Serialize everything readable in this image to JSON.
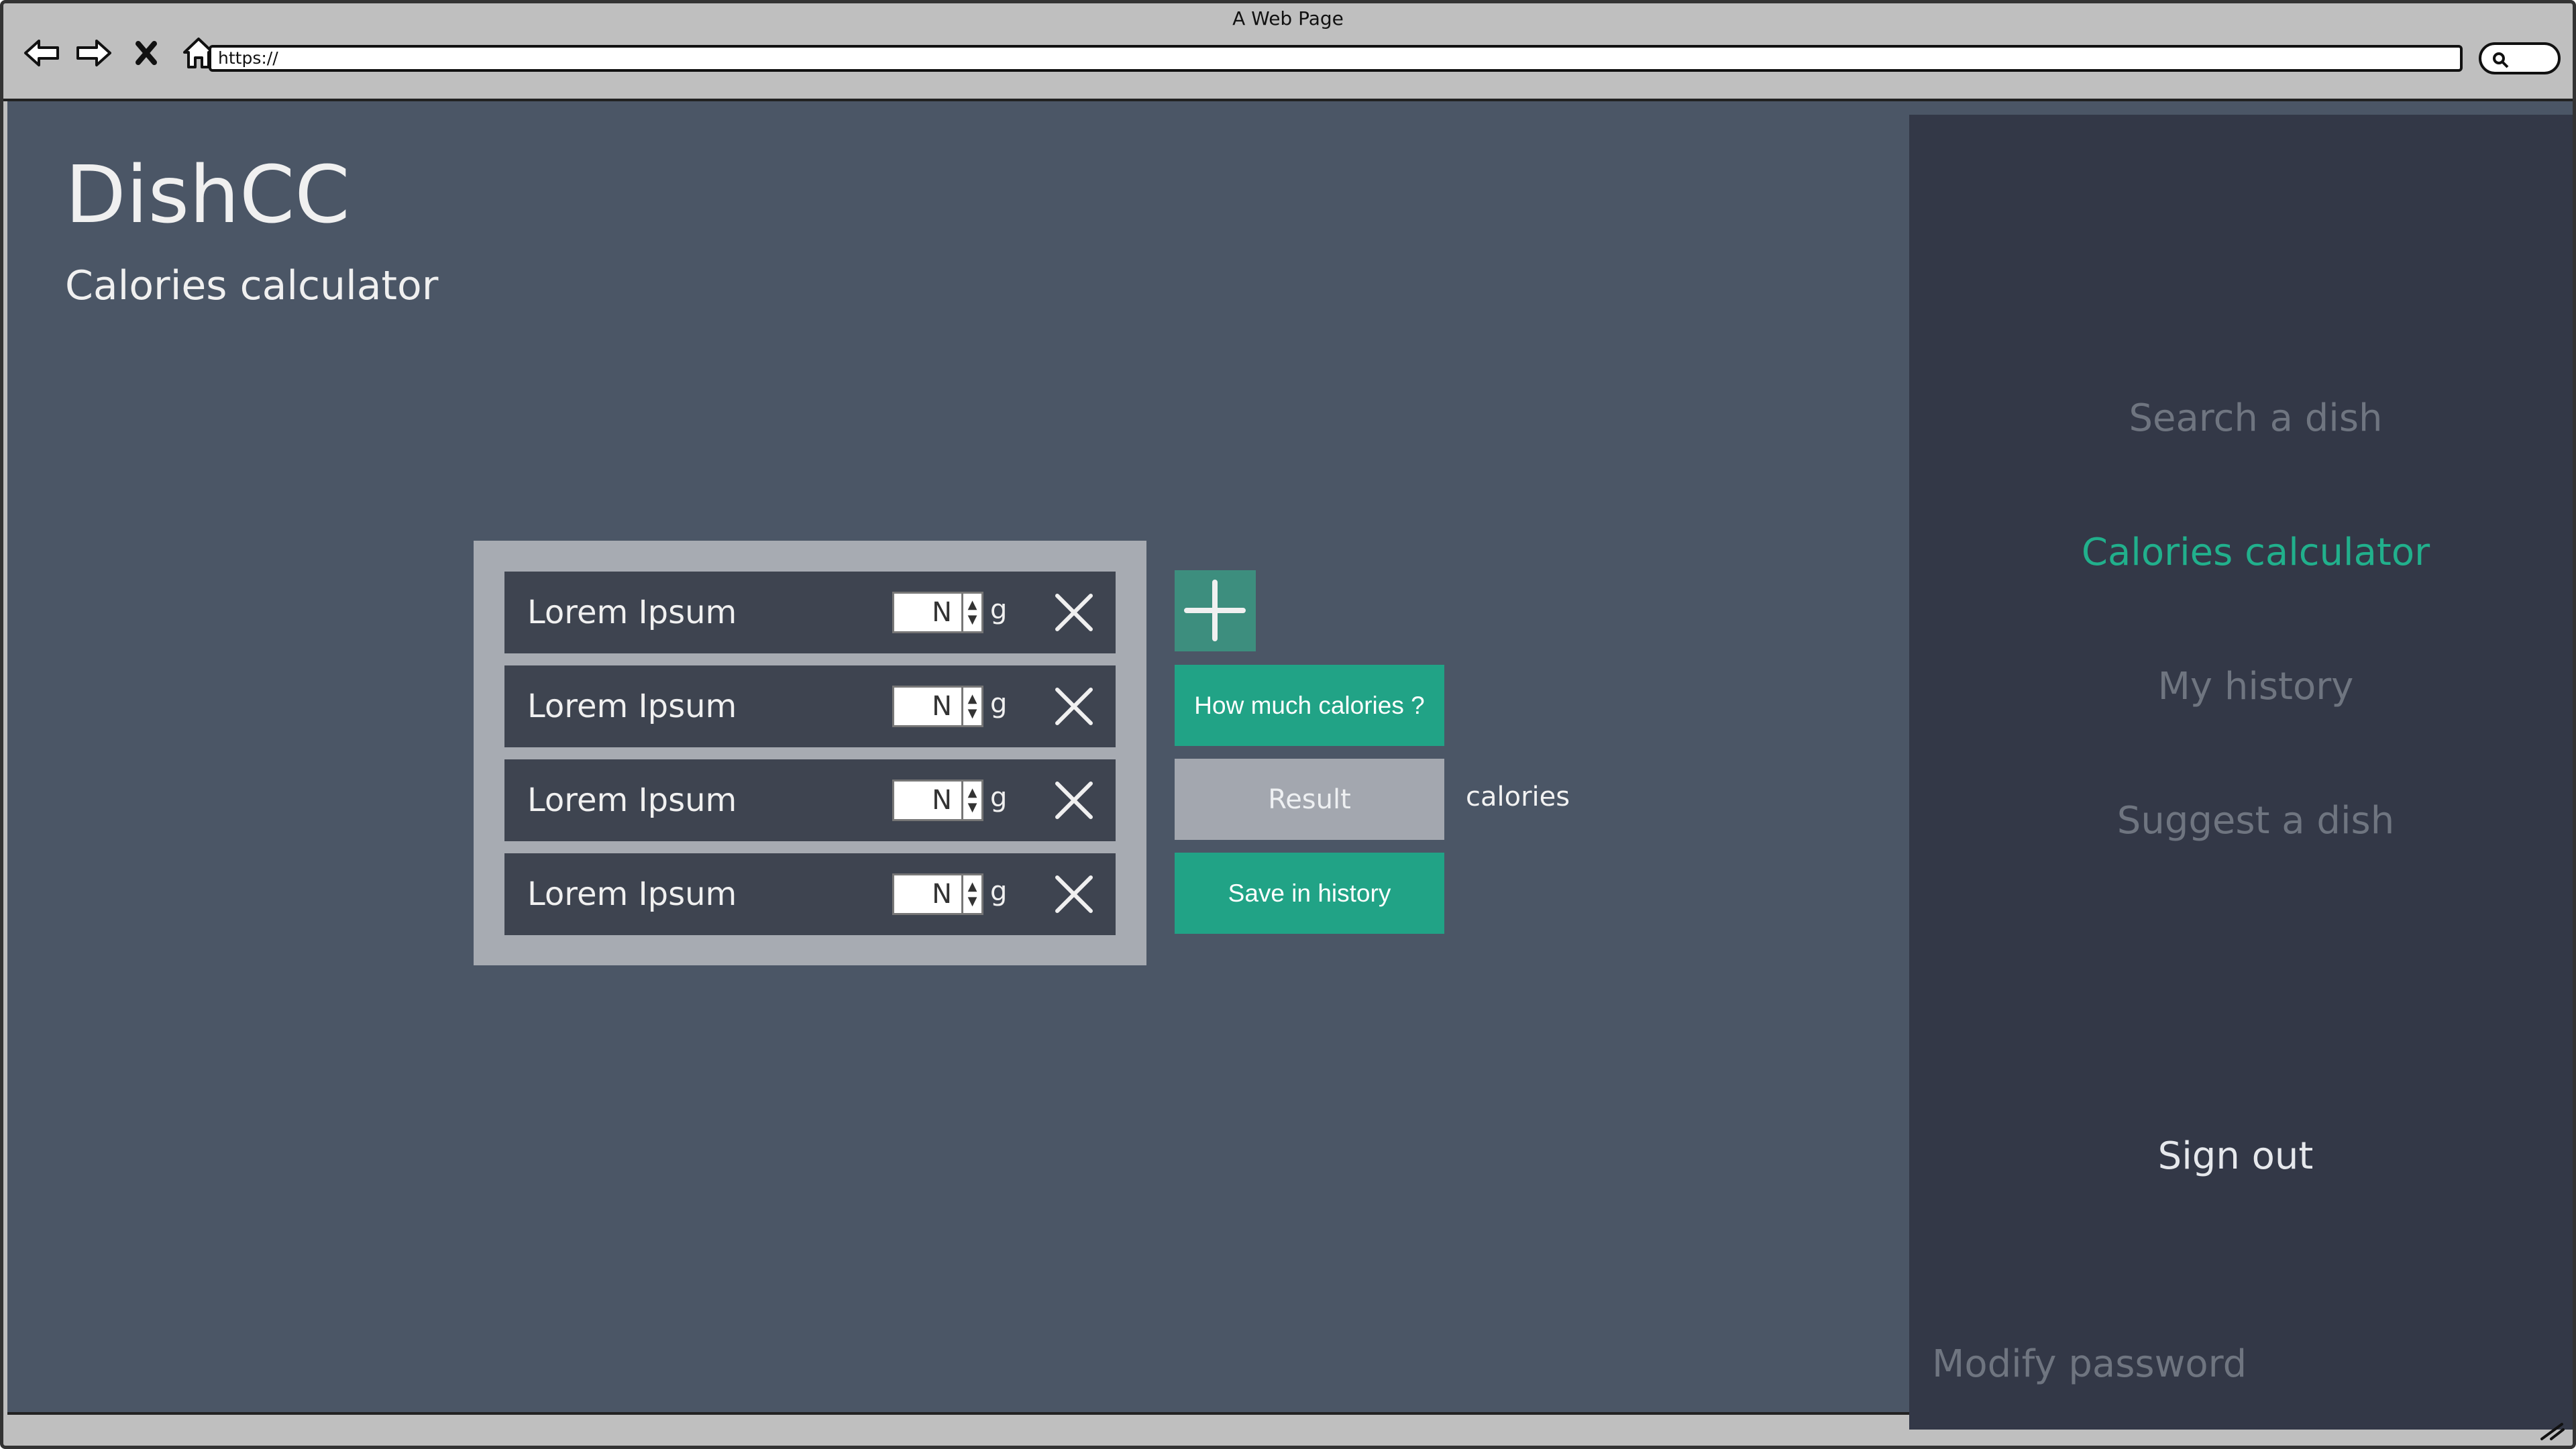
{
  "browser": {
    "title": "A Web Page",
    "url": "https://"
  },
  "header": {
    "app_title": "DishCC",
    "subtitle": "Calories calculator"
  },
  "ingredients": [
    {
      "name": "Lorem Ipsum",
      "quantity": "N",
      "unit": "g"
    },
    {
      "name": "Lorem Ipsum",
      "quantity": "N",
      "unit": "g"
    },
    {
      "name": "Lorem Ipsum",
      "quantity": "N",
      "unit": "g"
    },
    {
      "name": "Lorem Ipsum",
      "quantity": "N",
      "unit": "g"
    }
  ],
  "actions": {
    "calculate_label": "How much calories ?",
    "result_label": "Result",
    "result_unit": "calories",
    "save_label": "Save in history"
  },
  "sidebar": {
    "items": [
      {
        "label": "Search a dish",
        "active": false
      },
      {
        "label": "Calories calculator",
        "active": true
      },
      {
        "label": "My history",
        "active": false
      },
      {
        "label": "Suggest a dish",
        "active": false
      }
    ],
    "sign_out": "Sign out",
    "modify_password": "Modify password"
  },
  "colors": {
    "page_bg": "#4b5666",
    "sidebar_bg": "#333847",
    "accent": "#21a386",
    "active_nav": "#21b08c"
  }
}
